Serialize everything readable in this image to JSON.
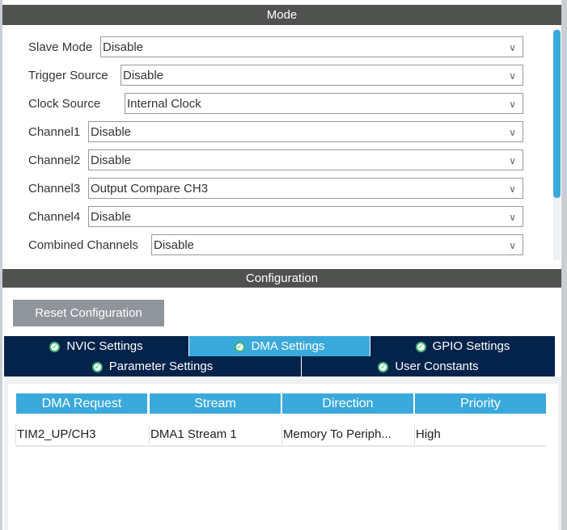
{
  "mode": {
    "title": "Mode",
    "fields": [
      {
        "label": "Slave Mode",
        "value": "Disable"
      },
      {
        "label": "Trigger Source",
        "value": "Disable"
      },
      {
        "label": "Clock Source",
        "value": "Internal Clock"
      },
      {
        "label": "Channel1",
        "value": "Disable"
      },
      {
        "label": "Channel2",
        "value": "Disable"
      },
      {
        "label": "Channel3",
        "value": "Output Compare CH3"
      },
      {
        "label": "Channel4",
        "value": "Disable"
      },
      {
        "label": "Combined Channels",
        "value": "Disable"
      }
    ]
  },
  "config": {
    "title": "Configuration",
    "reset_label": "Reset Configuration",
    "tabs": [
      "NVIC Settings",
      "DMA Settings",
      "GPIO Settings",
      "Parameter Settings",
      "User Constants"
    ],
    "table": {
      "headers": [
        "DMA Request",
        "Stream",
        "Direction",
        "Priority"
      ],
      "rows": [
        [
          "TIM2_UP/CH3",
          "DMA1 Stream 1",
          "Memory To Periph...",
          "High"
        ]
      ]
    }
  }
}
